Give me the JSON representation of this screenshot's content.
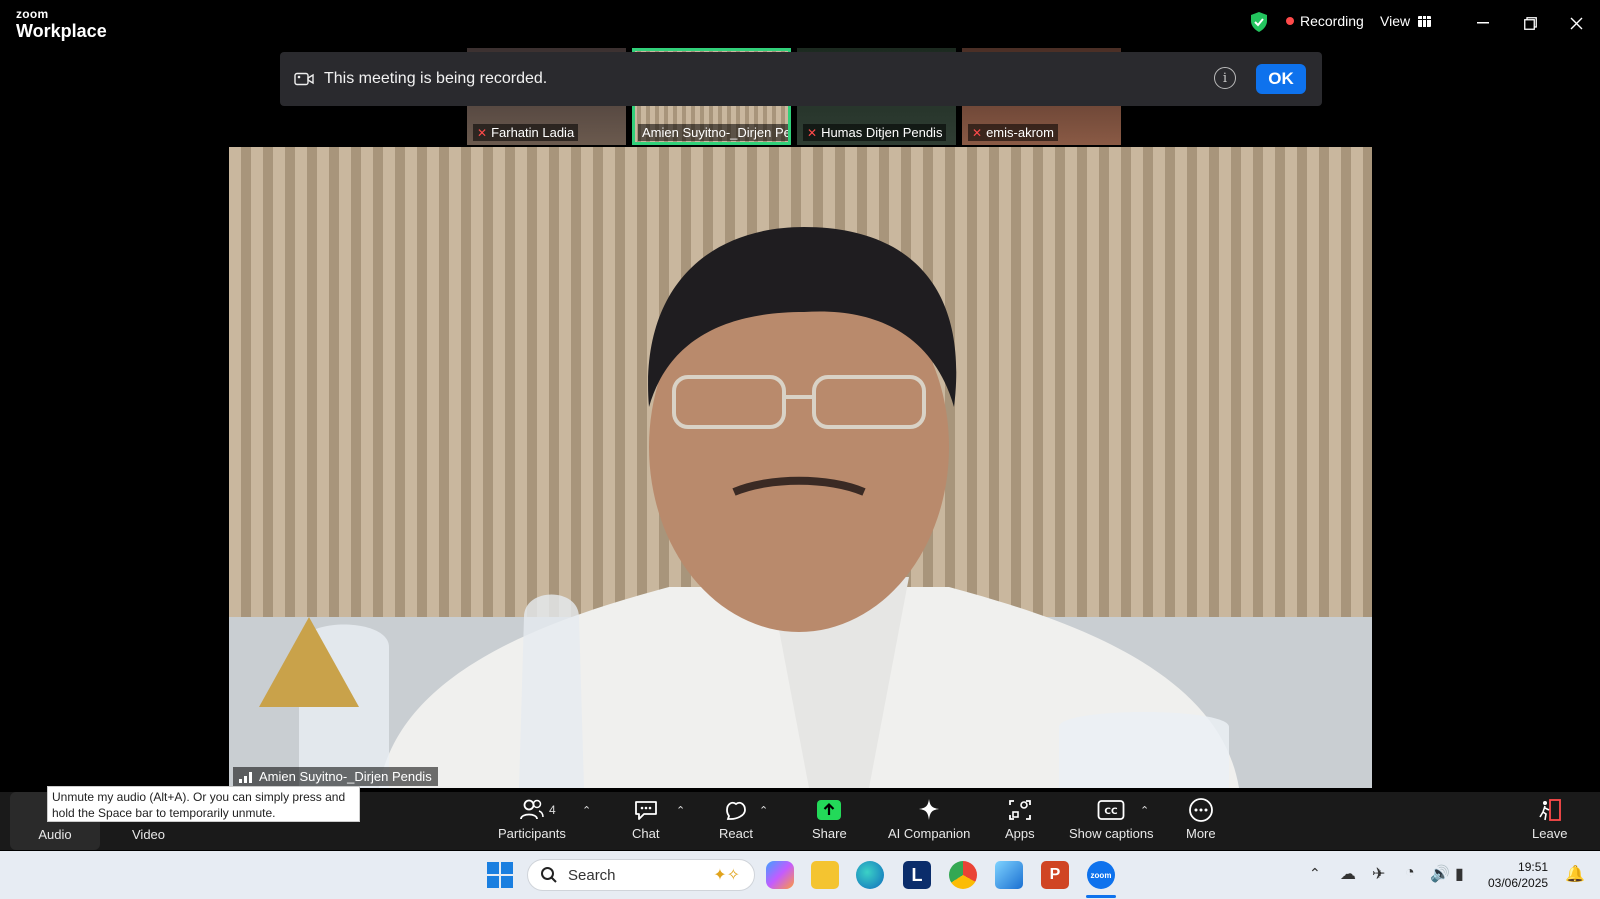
{
  "titlebar": {
    "brand_top": "zoom",
    "brand_bottom": "Workplace",
    "recording_label": "Recording",
    "view_label": "View"
  },
  "thumbnails": [
    {
      "name": "Farhatin Ladia",
      "muted": true,
      "active": false
    },
    {
      "name": "Amien Suyitno-_Dirjen Pe...",
      "muted": false,
      "active": true
    },
    {
      "name": "Humas Ditjen Pendis",
      "muted": true,
      "active": false
    },
    {
      "name": "emis-akrom",
      "muted": true,
      "active": false
    }
  ],
  "notice": {
    "text": "This meeting is being recorded.",
    "ok_label": "OK"
  },
  "main_video": {
    "speaker_name": "Amien Suyitno-_Dirjen Pendis"
  },
  "tooltip": {
    "text": "Unmute my audio (Alt+A). Or you can simply press and hold the Space bar to temporarily unmute."
  },
  "toolbar": {
    "audio": "Audio",
    "video": "Video",
    "participants": "Participants",
    "participants_count": "4",
    "chat": "Chat",
    "react": "React",
    "share": "Share",
    "ai_companion": "AI Companion",
    "apps": "Apps",
    "show_captions": "Show captions",
    "more": "More",
    "leave": "Leave"
  },
  "taskbar": {
    "search_placeholder": "Search",
    "time": "19:51",
    "date": "03/06/2025"
  },
  "colors": {
    "accent_blue": "#0e72ed",
    "active_green": "#31d07a",
    "share_green": "#23d959",
    "recording_red": "#ff4a4a"
  }
}
